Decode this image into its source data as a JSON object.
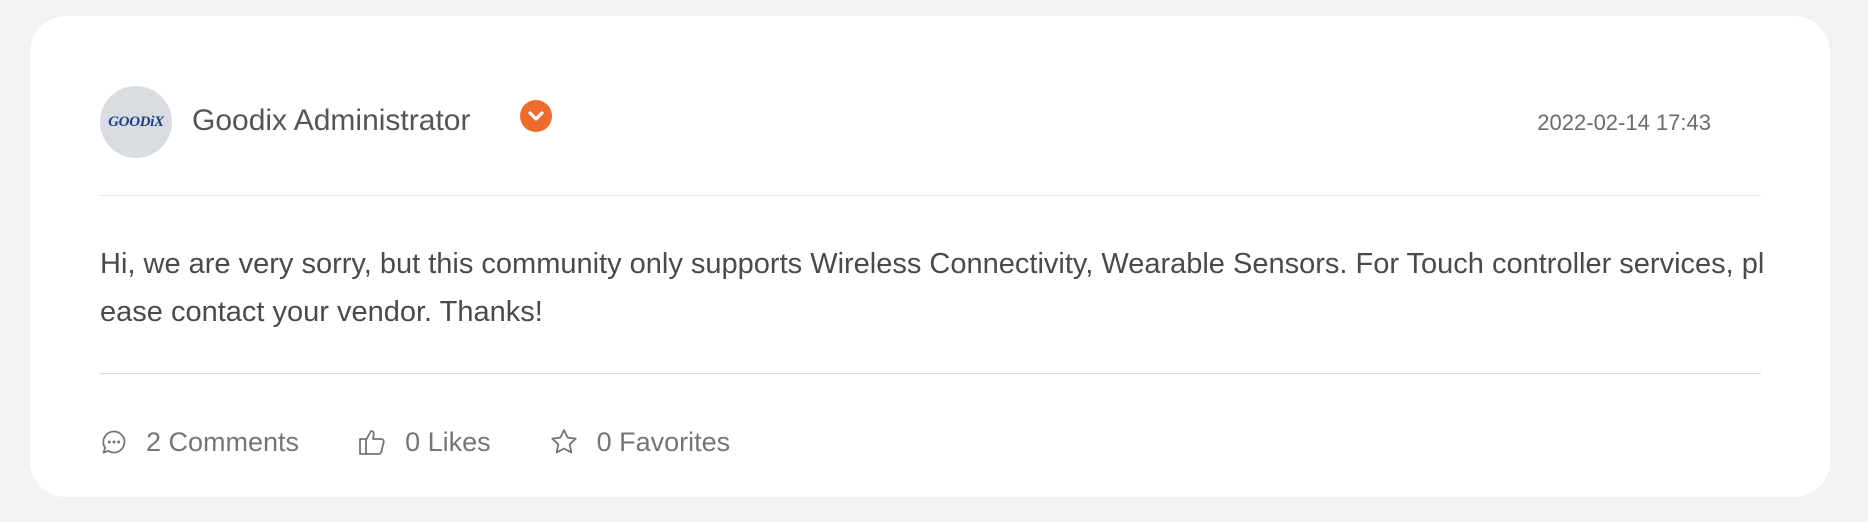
{
  "post": {
    "author": "Goodix Administrator",
    "avatar_text": "GOODiX",
    "badge_icon": "verified-chevron-icon",
    "date": "2022-02-14 17:43",
    "body": "Hi, we are very sorry, but this community only supports Wireless Connectivity, Wearable Sensors. For Touch controller services, please contact your vendor. Thanks!"
  },
  "actions": {
    "comments": "2 Comments",
    "likes": "0 Likes",
    "favorites": "0 Favorites"
  },
  "colors": {
    "badge": "#ef6a2d",
    "logo": "#1f3e8a"
  }
}
